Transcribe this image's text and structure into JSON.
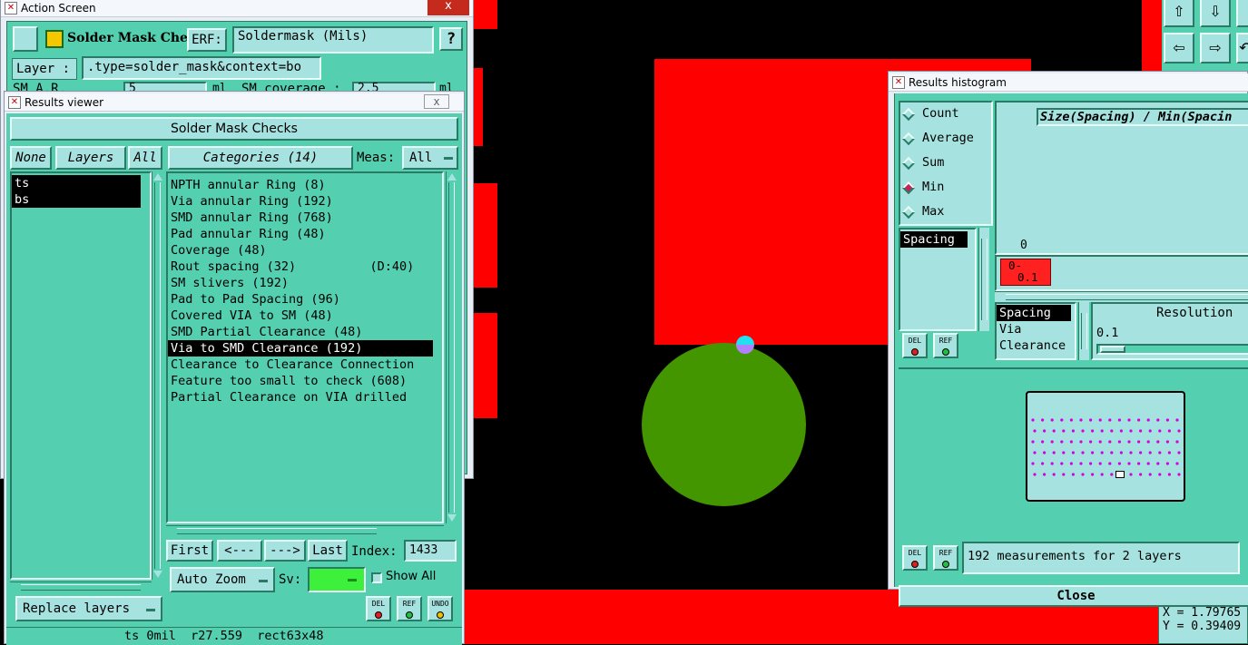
{
  "colors": {
    "pad_red": "#ff0000",
    "via_green": "#449600",
    "panel": "#54cfb0",
    "pale": "#a6e3e0"
  },
  "action_screen": {
    "title": "Action Screen",
    "close": "x",
    "header_label": "Solder Mask Checks",
    "erf_label": "ERF:",
    "erf_value": "Soldermask (Mils)",
    "help": "?",
    "layer_label": "Layer :",
    "layer_value": ".type=solder_mask&context=bo",
    "sm_ar_label": "SM A.R.",
    "sm_ar_value": "5",
    "sm_ar_unit": "ml",
    "sm_cov_label": "SM coverage :",
    "sm_cov_value": "2.5",
    "sm_cov_unit": "ml"
  },
  "results_viewer": {
    "title": "Results viewer",
    "close": "x",
    "header": "Solder Mask Checks",
    "none": "None",
    "layers": "Layers",
    "all": "All",
    "layer_items": [
      "ts",
      "bs"
    ],
    "categories_button": "Categories (14)",
    "meas_label": "Meas:",
    "meas_value": "All",
    "categories": [
      "NPTH annular Ring (8)",
      "Via annular Ring (192)",
      "SMD annular Ring (768)",
      "Pad annular Ring (48)",
      "Coverage (48)",
      "Rout spacing (32)          (D:40)",
      "SM slivers (192)",
      "Pad to Pad Spacing (96)",
      "Covered VIA to SM (48)",
      "SMD Partial Clearance (48)",
      "Via to SMD Clearance (192)",
      "Clearance to Clearance Connection",
      "Feature too small to check (608)",
      "Partial Clearance on VIA drilled"
    ],
    "selected_category": "Via to SMD Clearance (192)",
    "first": "First",
    "prev": "<---",
    "next": "--->",
    "last": "Last",
    "index_label": "Index:",
    "index_value": "1433",
    "auto_zoom": "Auto Zoom",
    "sv_label": "Sv:",
    "show_all": "Show All",
    "replace_layers": "Replace layers",
    "del": "DEL",
    "ref": "REF",
    "undo": "UNDO",
    "status": "ts 0mil  r27.559  rect63x48"
  },
  "histogram": {
    "title": "Results histogram",
    "modes": [
      "Count",
      "Average",
      "Sum",
      "Min",
      "Max"
    ],
    "selected_mode": "Min",
    "field_items": [
      "Spacing"
    ],
    "chart_title": "Size(Spacing) / Min(Spacin",
    "axis_zero": "0",
    "bin_label_top": "0-",
    "bin_label_bottom": "0.1",
    "category_items": [
      "Spacing",
      "Via",
      "Clearance"
    ],
    "resolution_label": "Resolution",
    "resolution_value": "0.1",
    "measurements": "192 measurements for 2 layers",
    "close": "Close",
    "del": "DEL",
    "ref": "REF"
  },
  "coords": {
    "x_label": "X = 1.79765",
    "y_label": "Y = 0.39409"
  }
}
